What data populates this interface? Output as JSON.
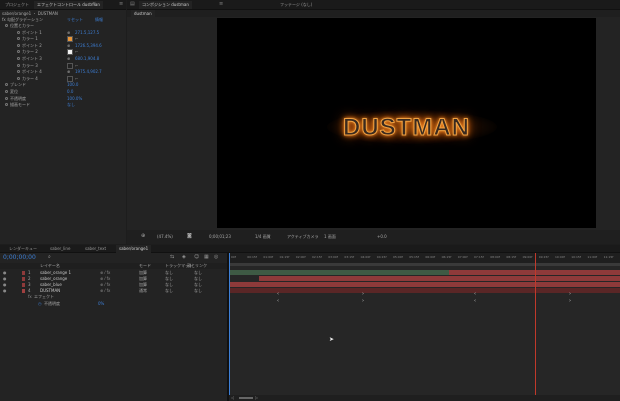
{
  "colors": {
    "accent_blue": "#3d7fd6",
    "timecode_blue": "#3d7fd6",
    "layer_red": "#8e3a3a",
    "layer_dark_red": "#5a2626",
    "layer_green": "#3e5a44",
    "playhead": "#c0392b",
    "orange_swatch": "#e8963a"
  },
  "effects_panel": {
    "tabs": [
      "プロジェクト",
      "エフェクトコントロール dustman"
    ],
    "header": "saber/orange1 ・ DUSTMAN",
    "group_label": "fx 勾配グラデーション",
    "group_link1": "リセット",
    "group_link2": "情報",
    "props": [
      {
        "label": "位置とカラー",
        "value": ""
      },
      {
        "label": "ポイント 1",
        "value": "271.5,127.5"
      },
      {
        "label": "カラー 1",
        "value": ""
      },
      {
        "label": "ポイント 2",
        "value": "1726.5,394.6"
      },
      {
        "label": "カラー 2",
        "value": ""
      },
      {
        "label": "ポイント 3",
        "value": "680.1,904.8"
      },
      {
        "label": "カラー 3",
        "value": ""
      },
      {
        "label": "ポイント 4",
        "value": "1975.4,902.7"
      },
      {
        "label": "カラー 4",
        "value": ""
      },
      {
        "label": "ブレンド",
        "value": "100.0"
      },
      {
        "label": "変位",
        "value": "0.0"
      },
      {
        "label": "不透明度",
        "value": "100.0%"
      },
      {
        "label": "描画モード",
        "value": "なし"
      }
    ]
  },
  "comp_panel": {
    "tabs": [
      "コンポジション dustman",
      "フッテージ (なし)"
    ],
    "subtab": "dustman",
    "title_text": "DUSTMAN",
    "toolbar": {
      "zoom": "(47.4%)",
      "timecode": "0;00;01;23",
      "quality": "1/4 画質",
      "view": "アクティブカメラ",
      "views": "1 画面",
      "offset": "+0.0"
    }
  },
  "timeline": {
    "tabs": [
      "レンダーキュー",
      "saber_line",
      "saber_text",
      "saber/orange1",
      "dustman"
    ],
    "timecode": "0;00;00;00",
    "columns": {
      "name": "レイヤー名",
      "mode": "モード",
      "trkmat": "トラックマット",
      "parent": "親とリンク"
    },
    "layers": [
      {
        "num": "1",
        "name": "saber_orange 1",
        "mode": "加算",
        "trk": "なし",
        "parent": "なし"
      },
      {
        "num": "2",
        "name": "saber_orange",
        "mode": "加算",
        "trk": "なし",
        "parent": "なし"
      },
      {
        "num": "3",
        "name": "saber_blue",
        "mode": "加算",
        "trk": "なし",
        "parent": "なし"
      },
      {
        "num": "4",
        "name": "DUSTMAN",
        "mode": "通常",
        "trk": "なし",
        "parent": "なし"
      }
    ],
    "effect_row": "エフェクト",
    "opacity_row": "不透明度",
    "opacity_value": "0%",
    "ruler": [
      "00f",
      "00:15f",
      "01:00f",
      "01:15f",
      "02:00f",
      "02:15f",
      "03:00f",
      "03:15f",
      "04:00f",
      "04:15f",
      "05:00f",
      "05:15f",
      "06:00f",
      "06:15f",
      "07:00f",
      "07:15f",
      "08:00f",
      "08:15f",
      "09:00f",
      "09:15f",
      "10:00f",
      "10:15f",
      "11:00f",
      "11:15f"
    ]
  }
}
